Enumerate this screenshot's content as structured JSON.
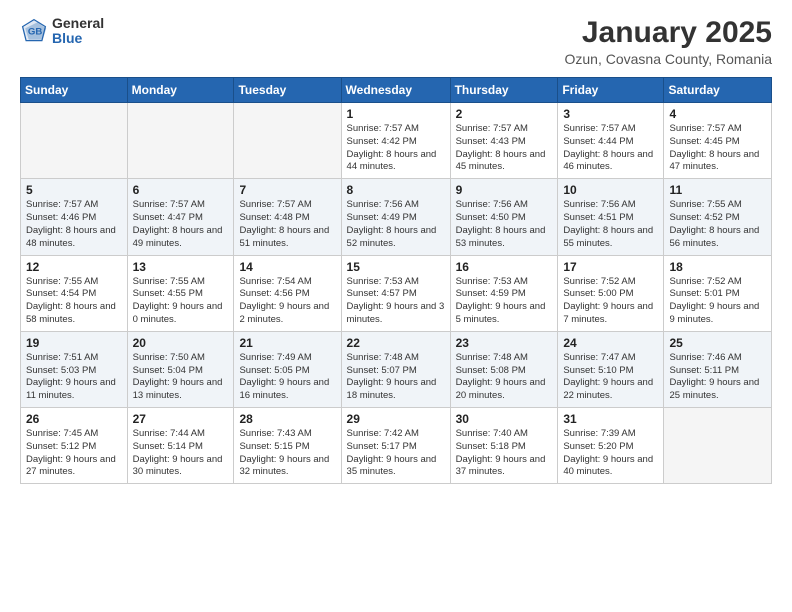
{
  "header": {
    "logo_general": "General",
    "logo_blue": "Blue",
    "month_title": "January 2025",
    "location": "Ozun, Covasna County, Romania"
  },
  "weekdays": [
    "Sunday",
    "Monday",
    "Tuesday",
    "Wednesday",
    "Thursday",
    "Friday",
    "Saturday"
  ],
  "weeks": [
    [
      {
        "day": "",
        "sunrise": "",
        "sunset": "",
        "daylight": ""
      },
      {
        "day": "",
        "sunrise": "",
        "sunset": "",
        "daylight": ""
      },
      {
        "day": "",
        "sunrise": "",
        "sunset": "",
        "daylight": ""
      },
      {
        "day": "1",
        "sunrise": "Sunrise: 7:57 AM",
        "sunset": "Sunset: 4:42 PM",
        "daylight": "Daylight: 8 hours and 44 minutes."
      },
      {
        "day": "2",
        "sunrise": "Sunrise: 7:57 AM",
        "sunset": "Sunset: 4:43 PM",
        "daylight": "Daylight: 8 hours and 45 minutes."
      },
      {
        "day": "3",
        "sunrise": "Sunrise: 7:57 AM",
        "sunset": "Sunset: 4:44 PM",
        "daylight": "Daylight: 8 hours and 46 minutes."
      },
      {
        "day": "4",
        "sunrise": "Sunrise: 7:57 AM",
        "sunset": "Sunset: 4:45 PM",
        "daylight": "Daylight: 8 hours and 47 minutes."
      }
    ],
    [
      {
        "day": "5",
        "sunrise": "Sunrise: 7:57 AM",
        "sunset": "Sunset: 4:46 PM",
        "daylight": "Daylight: 8 hours and 48 minutes."
      },
      {
        "day": "6",
        "sunrise": "Sunrise: 7:57 AM",
        "sunset": "Sunset: 4:47 PM",
        "daylight": "Daylight: 8 hours and 49 minutes."
      },
      {
        "day": "7",
        "sunrise": "Sunrise: 7:57 AM",
        "sunset": "Sunset: 4:48 PM",
        "daylight": "Daylight: 8 hours and 51 minutes."
      },
      {
        "day": "8",
        "sunrise": "Sunrise: 7:56 AM",
        "sunset": "Sunset: 4:49 PM",
        "daylight": "Daylight: 8 hours and 52 minutes."
      },
      {
        "day": "9",
        "sunrise": "Sunrise: 7:56 AM",
        "sunset": "Sunset: 4:50 PM",
        "daylight": "Daylight: 8 hours and 53 minutes."
      },
      {
        "day": "10",
        "sunrise": "Sunrise: 7:56 AM",
        "sunset": "Sunset: 4:51 PM",
        "daylight": "Daylight: 8 hours and 55 minutes."
      },
      {
        "day": "11",
        "sunrise": "Sunrise: 7:55 AM",
        "sunset": "Sunset: 4:52 PM",
        "daylight": "Daylight: 8 hours and 56 minutes."
      }
    ],
    [
      {
        "day": "12",
        "sunrise": "Sunrise: 7:55 AM",
        "sunset": "Sunset: 4:54 PM",
        "daylight": "Daylight: 8 hours and 58 minutes."
      },
      {
        "day": "13",
        "sunrise": "Sunrise: 7:55 AM",
        "sunset": "Sunset: 4:55 PM",
        "daylight": "Daylight: 9 hours and 0 minutes."
      },
      {
        "day": "14",
        "sunrise": "Sunrise: 7:54 AM",
        "sunset": "Sunset: 4:56 PM",
        "daylight": "Daylight: 9 hours and 2 minutes."
      },
      {
        "day": "15",
        "sunrise": "Sunrise: 7:53 AM",
        "sunset": "Sunset: 4:57 PM",
        "daylight": "Daylight: 9 hours and 3 minutes."
      },
      {
        "day": "16",
        "sunrise": "Sunrise: 7:53 AM",
        "sunset": "Sunset: 4:59 PM",
        "daylight": "Daylight: 9 hours and 5 minutes."
      },
      {
        "day": "17",
        "sunrise": "Sunrise: 7:52 AM",
        "sunset": "Sunset: 5:00 PM",
        "daylight": "Daylight: 9 hours and 7 minutes."
      },
      {
        "day": "18",
        "sunrise": "Sunrise: 7:52 AM",
        "sunset": "Sunset: 5:01 PM",
        "daylight": "Daylight: 9 hours and 9 minutes."
      }
    ],
    [
      {
        "day": "19",
        "sunrise": "Sunrise: 7:51 AM",
        "sunset": "Sunset: 5:03 PM",
        "daylight": "Daylight: 9 hours and 11 minutes."
      },
      {
        "day": "20",
        "sunrise": "Sunrise: 7:50 AM",
        "sunset": "Sunset: 5:04 PM",
        "daylight": "Daylight: 9 hours and 13 minutes."
      },
      {
        "day": "21",
        "sunrise": "Sunrise: 7:49 AM",
        "sunset": "Sunset: 5:05 PM",
        "daylight": "Daylight: 9 hours and 16 minutes."
      },
      {
        "day": "22",
        "sunrise": "Sunrise: 7:48 AM",
        "sunset": "Sunset: 5:07 PM",
        "daylight": "Daylight: 9 hours and 18 minutes."
      },
      {
        "day": "23",
        "sunrise": "Sunrise: 7:48 AM",
        "sunset": "Sunset: 5:08 PM",
        "daylight": "Daylight: 9 hours and 20 minutes."
      },
      {
        "day": "24",
        "sunrise": "Sunrise: 7:47 AM",
        "sunset": "Sunset: 5:10 PM",
        "daylight": "Daylight: 9 hours and 22 minutes."
      },
      {
        "day": "25",
        "sunrise": "Sunrise: 7:46 AM",
        "sunset": "Sunset: 5:11 PM",
        "daylight": "Daylight: 9 hours and 25 minutes."
      }
    ],
    [
      {
        "day": "26",
        "sunrise": "Sunrise: 7:45 AM",
        "sunset": "Sunset: 5:12 PM",
        "daylight": "Daylight: 9 hours and 27 minutes."
      },
      {
        "day": "27",
        "sunrise": "Sunrise: 7:44 AM",
        "sunset": "Sunset: 5:14 PM",
        "daylight": "Daylight: 9 hours and 30 minutes."
      },
      {
        "day": "28",
        "sunrise": "Sunrise: 7:43 AM",
        "sunset": "Sunset: 5:15 PM",
        "daylight": "Daylight: 9 hours and 32 minutes."
      },
      {
        "day": "29",
        "sunrise": "Sunrise: 7:42 AM",
        "sunset": "Sunset: 5:17 PM",
        "daylight": "Daylight: 9 hours and 35 minutes."
      },
      {
        "day": "30",
        "sunrise": "Sunrise: 7:40 AM",
        "sunset": "Sunset: 5:18 PM",
        "daylight": "Daylight: 9 hours and 37 minutes."
      },
      {
        "day": "31",
        "sunrise": "Sunrise: 7:39 AM",
        "sunset": "Sunset: 5:20 PM",
        "daylight": "Daylight: 9 hours and 40 minutes."
      },
      {
        "day": "",
        "sunrise": "",
        "sunset": "",
        "daylight": ""
      }
    ]
  ]
}
